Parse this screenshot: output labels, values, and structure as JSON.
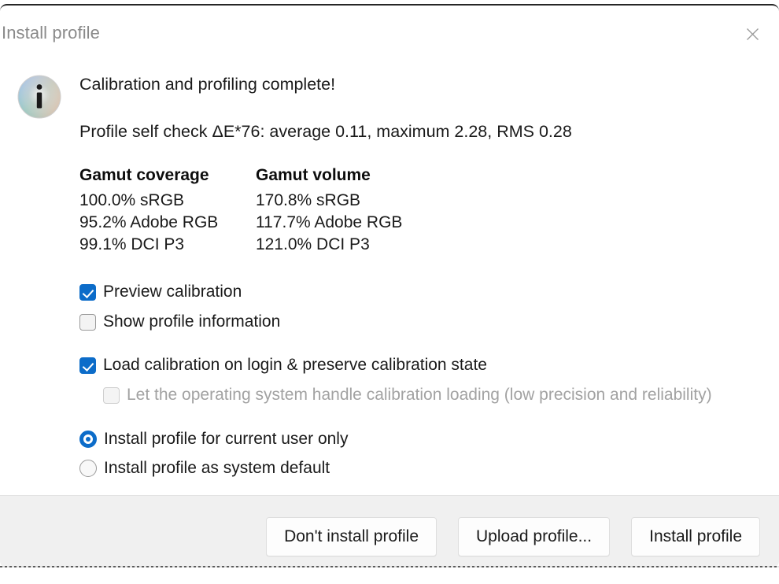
{
  "window": {
    "title": "Install profile",
    "close_icon": "close-icon"
  },
  "content": {
    "icon_name": "color-info-icon",
    "headline": "Calibration and profiling complete!",
    "self_check": "Profile self check ΔE*76: average 0.11, maximum 2.28, RMS 0.28"
  },
  "gamut": {
    "columns": [
      {
        "header": "Gamut coverage",
        "rows": [
          "100.0% sRGB",
          "95.2% Adobe RGB",
          "99.1% DCI P3"
        ]
      },
      {
        "header": "Gamut volume",
        "rows": [
          "170.8% sRGB",
          "117.7% Adobe RGB",
          "121.0% DCI P3"
        ]
      }
    ]
  },
  "options": {
    "preview_calibration": {
      "label": "Preview calibration",
      "checked": true
    },
    "show_profile_information": {
      "label": "Show profile information",
      "checked": false
    },
    "load_calibration_on_login": {
      "label": "Load calibration on login & preserve calibration state",
      "checked": true
    },
    "os_handle_calibration": {
      "label": "Let the operating system handle calibration loading (low precision and reliability)",
      "checked": false,
      "disabled": true
    },
    "install_current_user": {
      "label": "Install profile for current user only",
      "selected": true
    },
    "install_system_default": {
      "label": "Install profile as system default",
      "selected": false
    }
  },
  "footer": {
    "dont_install_label": "Don't install profile",
    "upload_label": "Upload profile...",
    "install_label": "Install profile"
  },
  "colors": {
    "accent": "#0c6cc9",
    "title_text": "#8a8a8a",
    "body_text": "#1a1a1a",
    "disabled_text": "#a2a2a2",
    "footer_bg": "#f0f0f0"
  }
}
